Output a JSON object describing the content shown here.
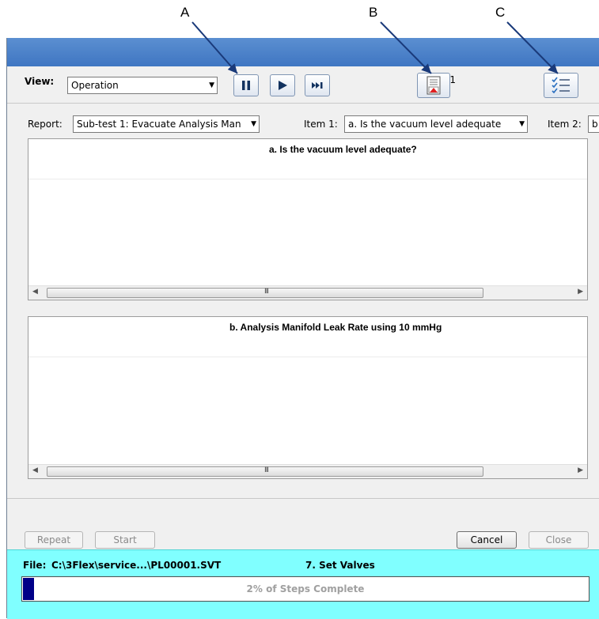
{
  "callouts": {
    "a": "A",
    "b": "B",
    "c": "C"
  },
  "toolbar": {
    "view_label": "View:",
    "view_value": "Operation",
    "report_count": "1"
  },
  "report_bar": {
    "report_label": "Report:",
    "report_value": "Sub-test 1: Evacuate Analysis Man",
    "item1_label": "Item 1:",
    "item1_value": "a. Is the vacuum level adequate",
    "item2_label": "Item 2:",
    "item2_value": "b"
  },
  "panels": [
    {
      "title": "a. Is the vacuum level adequate?"
    },
    {
      "title": "b. Analysis Manifold Leak Rate using 10 mmHg"
    }
  ],
  "scroll_grip": "III",
  "buttons": {
    "repeat": "Repeat",
    "start": "Start",
    "cancel": "Cancel",
    "close": "Close"
  },
  "status": {
    "file_label": "File:",
    "file_path": "C:\\3Flex\\service...\\PL00001.SVT",
    "step": "7. Set Valves",
    "progress_text": "2% of Steps Complete",
    "progress_fraction": 0.02
  },
  "colors": {
    "status_bg": "#80ffff",
    "progress_fill": "#000088",
    "titlebar": "#4a80c8"
  }
}
